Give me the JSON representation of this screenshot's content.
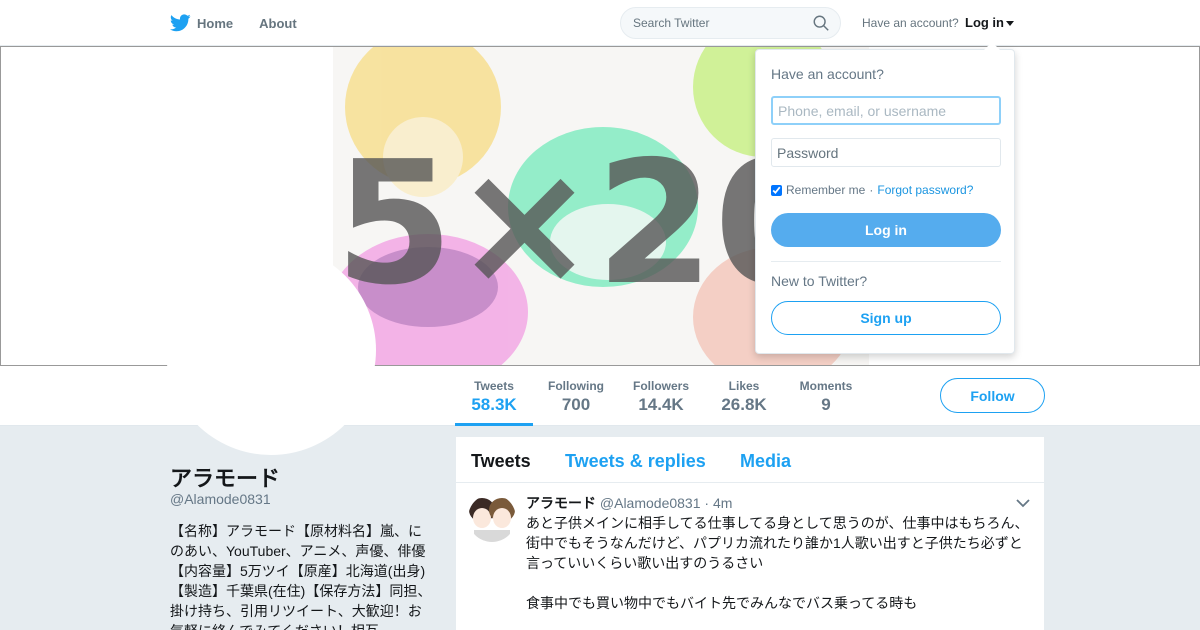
{
  "nav": {
    "home_label": "Home",
    "about_label": "About",
    "search_placeholder": "Search Twitter",
    "have_account": "Have an account?",
    "login_label": "Log in"
  },
  "banner": {
    "text": "5×20",
    "colors": [
      "#f5c842",
      "#ef7ee0",
      "#3ee5a0",
      "#aee85b",
      "#f0a08c"
    ]
  },
  "stats": [
    {
      "label": "Tweets",
      "value": "58.3K"
    },
    {
      "label": "Following",
      "value": "700"
    },
    {
      "label": "Followers",
      "value": "14.4K"
    },
    {
      "label": "Likes",
      "value": "26.8K"
    },
    {
      "label": "Moments",
      "value": "9"
    }
  ],
  "follow_label": "Follow",
  "profile": {
    "name": "アラモード",
    "handle": "@Alamode0831",
    "bio": "【名称】アラモード【原材料名】嵐、にのあい、YouTuber、アニメ、声優、俳優【内容量】5万ツイ【原産】北海道(出身)【製造】千葉県(在住)【保存方法】同担、掛け持ち、引用リツイート、大歓迎！お気軽に絡んでみてください！相互"
  },
  "tabs": [
    "Tweets",
    "Tweets & replies",
    "Media"
  ],
  "tweet": {
    "name": "アラモード",
    "handle": "@Alamode0831",
    "time": "· 4m",
    "text": "あと子供メインに相手してる仕事してる身として思うのが、仕事中はもちろん、街中でもそうなんだけど、パプリカ流れたり誰か1人歌い出すと子供たち必ずと言っていいくらい歌い出すのうるさい\n\n食事中でも買い物中でもバイト先でみんなでバス乗ってる時も"
  },
  "login": {
    "title": "Have an account?",
    "username_placeholder": "Phone, email, or username",
    "password_placeholder": "Password",
    "remember": "Remember me",
    "separator": "·",
    "forgot": "Forgot password?",
    "button": "Log in",
    "new_to_twitter": "New to Twitter?",
    "signup": "Sign up"
  },
  "colors": {
    "brand_blue": "#1da1f2",
    "login_button": "#55acee"
  }
}
